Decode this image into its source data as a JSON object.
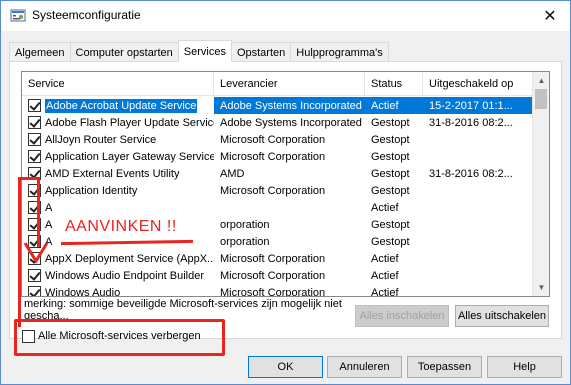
{
  "window": {
    "title": "Systeemconfiguratie",
    "icons": {
      "app": "system-config-icon",
      "close": "close-icon"
    }
  },
  "tabs": [
    {
      "label": "Algemeen",
      "active": false
    },
    {
      "label": "Computer opstarten",
      "active": false
    },
    {
      "label": "Services",
      "active": true
    },
    {
      "label": "Opstarten",
      "active": false
    },
    {
      "label": "Hulpprogramma's",
      "active": false
    }
  ],
  "services_table": {
    "columns": [
      "Service",
      "Leverancier",
      "Status",
      "Uitgeschakeld op"
    ],
    "rows": [
      {
        "checked": true,
        "name": "Adobe Acrobat Update Service",
        "vendor": "Adobe Systems Incorporated",
        "status": "Actief",
        "disabled_on": "15-2-2017 01:1...",
        "selected": true
      },
      {
        "checked": true,
        "name": "Adobe Flash Player Update Service",
        "vendor": "Adobe Systems Incorporated",
        "status": "Gestopt",
        "disabled_on": "31-8-2016 08:2..."
      },
      {
        "checked": true,
        "name": "AllJoyn Router Service",
        "vendor": "Microsoft Corporation",
        "status": "Gestopt",
        "disabled_on": ""
      },
      {
        "checked": true,
        "name": "Application Layer Gateway Service",
        "vendor": "Microsoft Corporation",
        "status": "Gestopt",
        "disabled_on": ""
      },
      {
        "checked": true,
        "name": "AMD External Events Utility",
        "vendor": "AMD",
        "status": "Gestopt",
        "disabled_on": "31-8-2016 08:2..."
      },
      {
        "checked": true,
        "name": "Application Identity",
        "vendor": "Microsoft Corporation",
        "status": "Gestopt",
        "disabled_on": ""
      },
      {
        "checked": true,
        "name": "A",
        "vendor": "",
        "status": "Actief",
        "disabled_on": ""
      },
      {
        "checked": true,
        "name": "A",
        "vendor": "orporation",
        "status": "Gestopt",
        "disabled_on": ""
      },
      {
        "checked": true,
        "name": "A",
        "vendor": "orporation",
        "status": "Gestopt",
        "disabled_on": ""
      },
      {
        "checked": true,
        "name": "AppX Deployment Service (AppX...",
        "vendor": "Microsoft Corporation",
        "status": "Actief",
        "disabled_on": ""
      },
      {
        "checked": true,
        "name": "Windows Audio Endpoint Builder",
        "vendor": "Microsoft Corporation",
        "status": "Actief",
        "disabled_on": ""
      },
      {
        "checked": true,
        "name": "Windows Audio",
        "vendor": "Microsoft Corporation",
        "status": "Actief",
        "disabled_on": ""
      }
    ]
  },
  "note": "merking: sommige beveiligde Microsoft-services zijn mogelijk niet gescha...",
  "buttons": {
    "enable_all": "Alles inschakelen",
    "disable_all": "Alles uitschakelen",
    "ok": "OK",
    "cancel": "Annuleren",
    "apply": "Toepassen",
    "help": "Help"
  },
  "hide_ms": {
    "label": "Alle Microsoft-services verbergen",
    "checked": false
  },
  "annotation": {
    "text": "AANVINKEN !!",
    "color": "#e8251f"
  }
}
